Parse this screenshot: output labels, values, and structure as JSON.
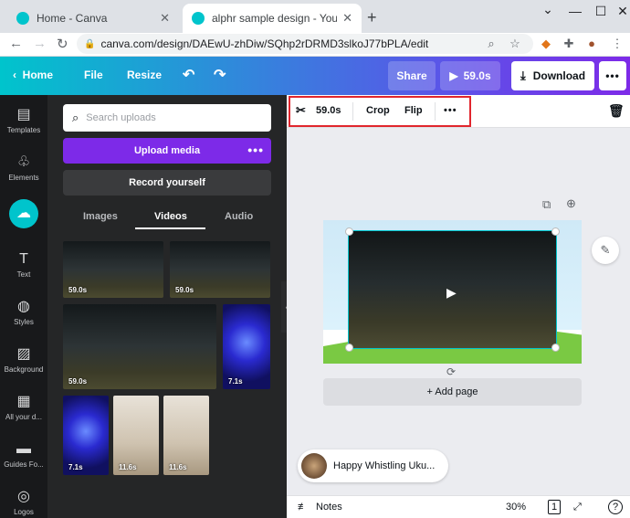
{
  "browser": {
    "tabs": [
      {
        "title": "Home - Canva",
        "active": false
      },
      {
        "title": "alphr sample design - YouTube T",
        "active": true
      }
    ],
    "url": "canva.com/design/DAEwU-zhDiw/SQhp2rDRMD3slkoJ77bPLA/edit"
  },
  "header": {
    "home": "Home",
    "file": "File",
    "resize": "Resize",
    "share": "Share",
    "play_duration": "59.0s",
    "download": "Download"
  },
  "rail": [
    {
      "label": "Templates",
      "icon": "templates-icon"
    },
    {
      "label": "Elements",
      "icon": "elements-icon"
    },
    {
      "label": "",
      "icon": "upload-cloud-icon"
    },
    {
      "label": "Text",
      "icon": "text-icon"
    },
    {
      "label": "Styles",
      "icon": "palette-icon"
    },
    {
      "label": "Background",
      "icon": "background-icon"
    },
    {
      "label": "All your d...",
      "icon": "grid-icon"
    },
    {
      "label": "Guides Fo...",
      "icon": "guides-icon"
    },
    {
      "label": "Logos",
      "icon": "logos-icon"
    }
  ],
  "panel": {
    "search_placeholder": "Search uploads",
    "upload_media": "Upload media",
    "record_yourself": "Record yourself",
    "tabs": [
      "Images",
      "Videos",
      "Audio"
    ],
    "active_tab": "Videos",
    "thumbs": [
      "59.0s",
      "59.0s",
      "59.0s",
      "7.1s",
      "7.1s",
      "11.6s",
      "11.6s"
    ]
  },
  "context_toolbar": {
    "duration": "59.0s",
    "crop": "Crop",
    "flip": "Flip",
    "more": "•••"
  },
  "editor": {
    "add_page": "+ Add page",
    "audio_title": "Happy Whistling Uku...",
    "notes": "Notes",
    "zoom": "30%",
    "page_count": "1"
  },
  "colors": {
    "accent_purple": "#7d2ae8",
    "teal": "#00c4cc",
    "highlight_red": "#e1262d"
  }
}
